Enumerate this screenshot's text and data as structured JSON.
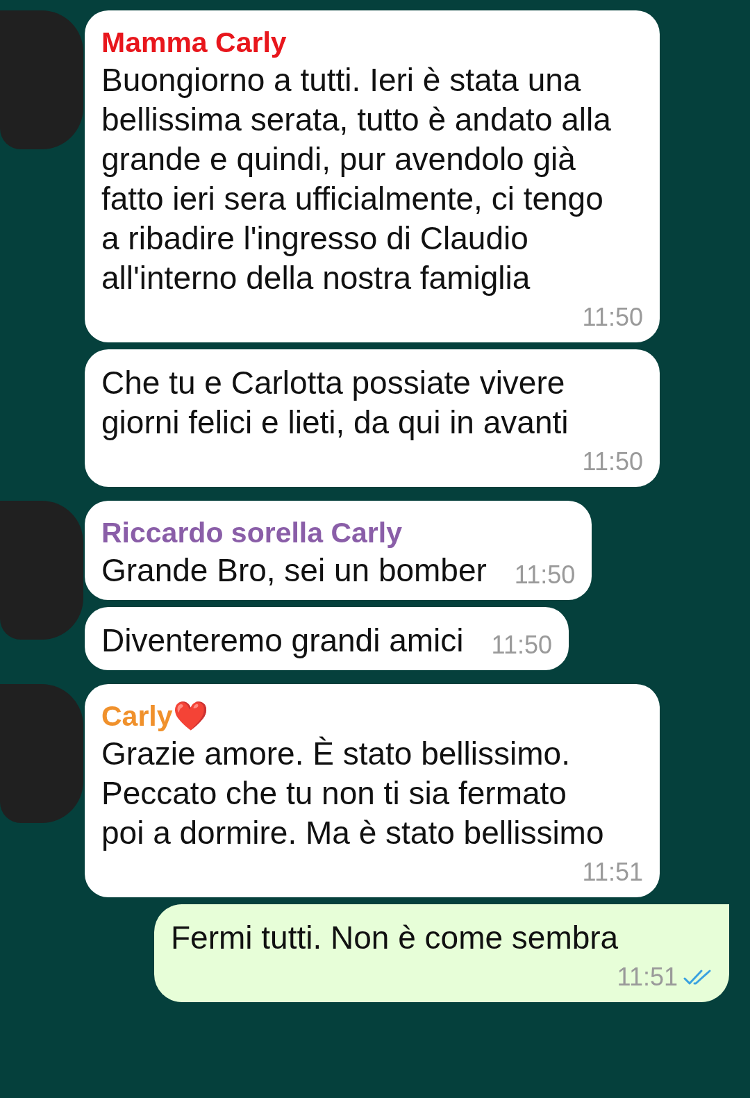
{
  "messages": [
    {
      "kind": "incoming",
      "sender": "Mamma Carly",
      "color": "#e8161c",
      "text": "Buongiorno a tutti. Ieri è stata una bellissima serata, tutto è andato alla grande e quindi, pur avendolo già fatto ieri sera ufficialmente, ci tengo a ribadire l'ingresso di Claudio all'interno della nostra famiglia",
      "time": "11:50"
    },
    {
      "kind": "incoming",
      "text": "Che tu e Carlotta possiate vivere giorni felici e lieti, da qui in avanti",
      "time": "11:50"
    },
    {
      "kind": "incoming",
      "sender": "Riccardo sorella Carly",
      "color": "#8a5ea8",
      "text": "Grande Bro, sei un bomber",
      "time": "11:50"
    },
    {
      "kind": "incoming",
      "text": "Diventeremo grandi amici",
      "time": "11:50"
    },
    {
      "kind": "incoming",
      "sender": "Carly❤️",
      "color": "#f0912c",
      "text": "Grazie amore. È stato bellissimo. Peccato che tu non ti sia fermato poi a dormire. Ma è stato bellissimo",
      "time": "11:51"
    },
    {
      "kind": "outgoing",
      "text": "Fermi tutti. Non è come sembra",
      "time": "11:51",
      "read": true
    }
  ]
}
